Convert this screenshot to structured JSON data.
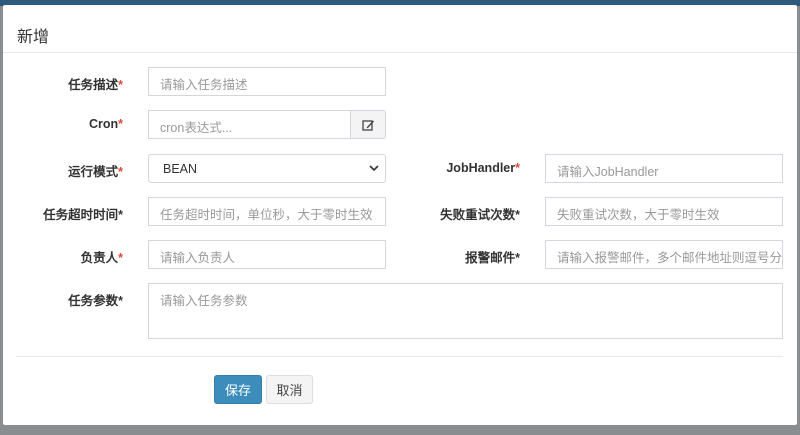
{
  "modal": {
    "title": "新增"
  },
  "fields": {
    "desc": {
      "label": "任务描述",
      "placeholder": "请输入任务描述"
    },
    "cron": {
      "label": "Cron",
      "placeholder": "cron表达式..."
    },
    "mode": {
      "label": "运行模式",
      "value": "BEAN"
    },
    "handler": {
      "label": "JobHandler",
      "placeholder": "请输入JobHandler"
    },
    "timeout": {
      "label": "任务超时时间",
      "placeholder": "任务超时时间，单位秒，大于零时生效"
    },
    "retry": {
      "label": "失败重试次数",
      "placeholder": "失败重试次数，大于零时生效"
    },
    "author": {
      "label": "负责人",
      "placeholder": "请输入负责人"
    },
    "alarm": {
      "label": "报警邮件",
      "placeholder": "请输入报警邮件，多个邮件地址则逗号分隔"
    },
    "param": {
      "label": "任务参数",
      "placeholder": "请输入任务参数"
    }
  },
  "asterisk": "*",
  "buttons": {
    "save": "保存",
    "cancel": "取消"
  }
}
